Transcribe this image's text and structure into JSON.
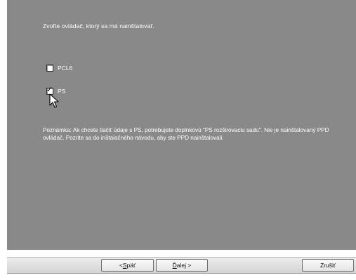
{
  "prompt_text": "Zvoľte ovládač, ktorý sa má nainštalovať.",
  "options": [
    {
      "label": "PCL6",
      "checked": false
    },
    {
      "label": "PS",
      "checked": true
    }
  ],
  "note_text": "Poznámka: Ak chcete tlačiť údaje s PS, potrebujete doplnkovú \"PS rozširovaciu sadu\". Nie je nainštalovaný PPD ovládač. Pozrite sa do inštalačného návodu, aby ste PPD nainštalovali.",
  "buttons": {
    "back": {
      "prefix": "< ",
      "accel": "S",
      "rest": "päť"
    },
    "next": {
      "accel": "Ď",
      "rest": "alej >"
    },
    "cancel": "Zrušiť"
  },
  "colors": {
    "content_bg": "#898989",
    "text": "#ffffff"
  },
  "icons": {
    "cursor": "arrow-pointer-icon",
    "checkmark": "checkmark-icon"
  }
}
